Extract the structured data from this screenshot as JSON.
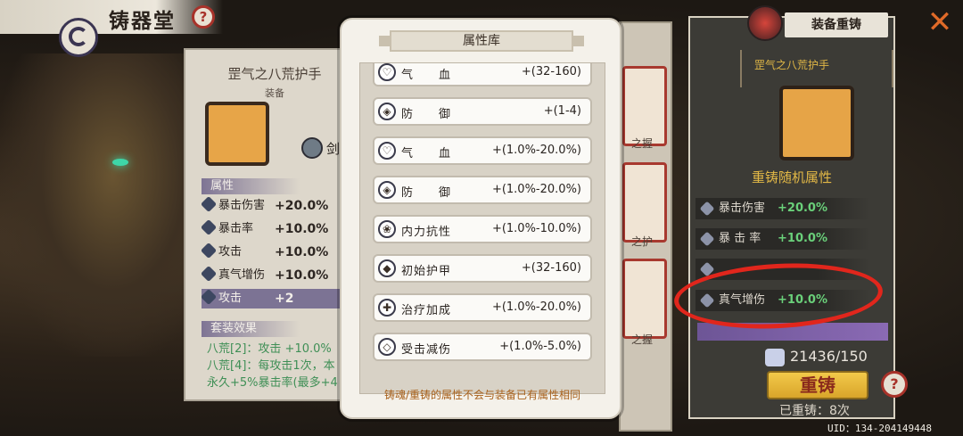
{
  "page_title": "铸器堂",
  "help_glyph": "?",
  "left_panel": {
    "item_name": "罡气之八荒护手",
    "item_type": "装备",
    "gem_label": "剑",
    "attr_header": "属性",
    "attributes": [
      {
        "name": "暴击伤害",
        "value": "+20.0%"
      },
      {
        "name": "暴击率",
        "value": "+10.0%"
      },
      {
        "name": "攻击",
        "value": "+10.0%"
      },
      {
        "name": "真气增伤",
        "value": "+10.0%"
      },
      {
        "name": "攻击",
        "value": "+2"
      }
    ],
    "set_header": "套装效果",
    "set_lines": [
      "八荒[2]：攻击 +10.0%",
      "八荒[4]：每攻击1次，本",
      "永久+5%暴击率(最多+4"
    ]
  },
  "modal": {
    "title": "属性库",
    "rows": [
      {
        "name": "气　　血",
        "value": "+(32-160)",
        "icon": "heart-icon",
        "glyph": "♡"
      },
      {
        "name": "防　　御",
        "value": "+(1-4)",
        "icon": "shield-icon",
        "glyph": "◈"
      },
      {
        "name": "气　　血",
        "value": "+(1.0%-20.0%)",
        "icon": "heart-icon",
        "glyph": "♡"
      },
      {
        "name": "防　　御",
        "value": "+(1.0%-20.0%)",
        "icon": "shield-icon",
        "glyph": "◈"
      },
      {
        "name": "内力抗性",
        "value": "+(1.0%-10.0%)",
        "icon": "swirl-icon",
        "glyph": "❀"
      },
      {
        "name": "初始护甲",
        "value": "+(32-160)",
        "icon": "armor-icon",
        "glyph": "◆"
      },
      {
        "name": "治疗加成",
        "value": "+(1.0%-20.0%)",
        "icon": "heal-icon",
        "glyph": "✚"
      },
      {
        "name": "受击减伤",
        "value": "+(1.0%-5.0%)",
        "icon": "defense-icon",
        "glyph": "◇"
      }
    ],
    "note": "铸魂/重铸的属性不会与装备已有属性相同"
  },
  "cards": [
    {
      "label": "之握"
    },
    {
      "label": "之护"
    },
    {
      "label": "之握"
    }
  ],
  "reforge": {
    "title": "装备重铸",
    "item_name": "罡气之八荒护手",
    "sub_title": "重铸随机属性",
    "rows": [
      {
        "name": "暴击伤害",
        "value": "+20.0%"
      },
      {
        "name": "暴 击 率",
        "value": "+10.0%"
      },
      {
        "name": "",
        "value": ""
      },
      {
        "name": "真气增伤",
        "value": "+10.0%"
      }
    ],
    "cost": "21436/150",
    "button_label": "重铸",
    "count": "已重铸：8次"
  },
  "uid": "UID：134-204149448",
  "colors": {
    "accent_red": "#a8322a",
    "gold": "#e2b846",
    "green": "#6ad07a",
    "annotation": "#e1261c"
  }
}
